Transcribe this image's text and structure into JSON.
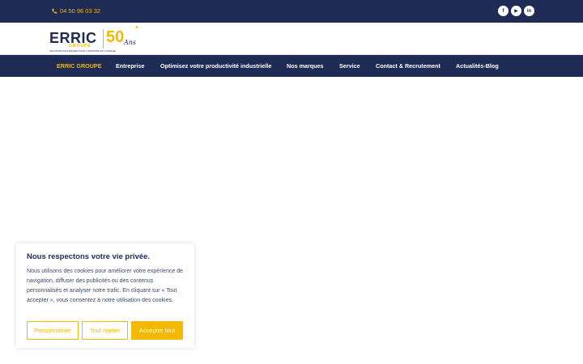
{
  "topbar": {
    "phone": "04 50 96 03 32",
    "socials": [
      {
        "icon": "facebook-icon",
        "glyph": "f"
      },
      {
        "icon": "youtube-icon",
        "glyph": "▶"
      },
      {
        "icon": "linkedin-icon",
        "glyph": "in"
      }
    ]
  },
  "logo": {
    "brand": "ERRIC",
    "sub": "GROUPE",
    "tagline": "SOLUTIONS TECHNIQUES POUR L'INDUSTRIE ET L'USINAGE",
    "anniversary": "50",
    "anniversary_suffix": "Ans",
    "accent_color": "#f5b800",
    "brand_color": "#1d2b55"
  },
  "nav": {
    "items": [
      {
        "label": "ERRIC GROUPE",
        "active": true
      },
      {
        "label": "Entreprise",
        "active": false
      },
      {
        "label": "Optimisez votre productivité industrielle",
        "active": false
      },
      {
        "label": "Nos marques",
        "active": false
      },
      {
        "label": "Service",
        "active": false
      },
      {
        "label": "Contact & Recrutement",
        "active": false
      },
      {
        "label": "Actualités-Blog",
        "active": false
      }
    ]
  },
  "cookie": {
    "title": "Nous respectons votre vie privée.",
    "text": "Nous utilisons des cookies pour améliorer votre expérience de navigation, diffuser des publicités ou des contenus personnalisés et analyser notre trafic. En cliquant sur « Tout accepter », vous consentez à notre utilisation des cookies.",
    "customize_label": "Personnaliser",
    "reject_label": "Tout rejeter",
    "accept_label": "Accepter tout"
  }
}
